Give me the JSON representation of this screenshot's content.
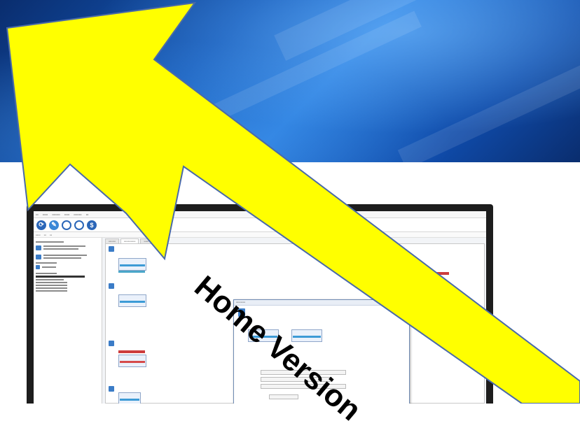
{
  "banner": {
    "arrow_label": "Home Version",
    "arrow_color": "#ffff00",
    "background_color": "#1358b8"
  },
  "screenshot": {
    "toolbar_icons": [
      "clone-icon",
      "tools-icon",
      "help-icon",
      "search-globe-icon",
      "info-icon"
    ]
  }
}
